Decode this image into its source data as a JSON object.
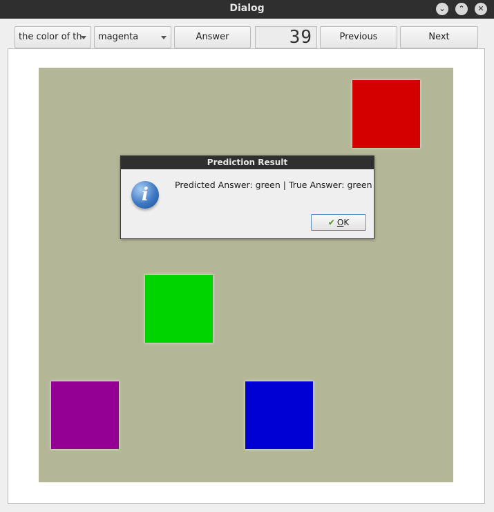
{
  "window": {
    "title": "Dialog",
    "controls": [
      "minimize",
      "maximize",
      "close"
    ]
  },
  "toolbar": {
    "question_combo": "the color of th",
    "color_combo": "magenta",
    "answer_label": "Answer",
    "counter": "39",
    "previous_label": "Previous",
    "next_label": "Next"
  },
  "scene": {
    "background_color": "#b4b698",
    "squares": [
      {
        "color": "#d40000",
        "name": "red"
      },
      {
        "color": "#00d400",
        "name": "green"
      },
      {
        "color": "#940094",
        "name": "purple"
      },
      {
        "color": "#0000d4",
        "name": "blue"
      }
    ]
  },
  "message_box": {
    "title": "Prediction Result",
    "text": "Predicted Answer: green | True Answer: green",
    "icon": "info-icon",
    "ok_label_underlined": "O",
    "ok_label_rest": "K"
  }
}
